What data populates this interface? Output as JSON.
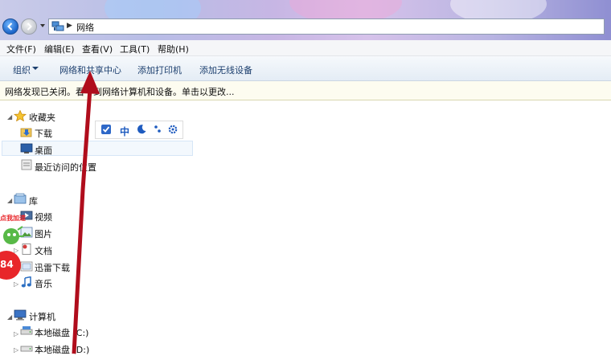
{
  "address": {
    "path": "网络"
  },
  "menu": {
    "file": "文件(F)",
    "edit": "编辑(E)",
    "view": "查看(V)",
    "tools": "工具(T)",
    "help": "帮助(H)"
  },
  "commands": {
    "organize": "组织",
    "network_center": "网络和共享中心",
    "add_printer": "添加打印机",
    "add_wireless": "添加无线设备"
  },
  "infobar": {
    "text": "网络发现已关闭。看不到网络计算机和设备。单击以更改..."
  },
  "nav": {
    "favorites": "收藏夹",
    "downloads": "下载",
    "desktop": "桌面",
    "recent": "最近访问的位置",
    "libraries": "库",
    "videos": "视频",
    "pictures": "图片",
    "documents": "文档",
    "thunder": "迅雷下载",
    "music": "音乐",
    "computer": "计算机",
    "disk_c": "本地磁盘 (C:)",
    "disk_d": "本地磁盘 (D:)"
  },
  "langbar": {
    "mode": "中"
  },
  "promo": {
    "label": "点我加速",
    "number": "84"
  },
  "colors": {
    "accent": "#1c3f6e",
    "arrow": "#b00d1c",
    "badge": "#e8262a"
  }
}
